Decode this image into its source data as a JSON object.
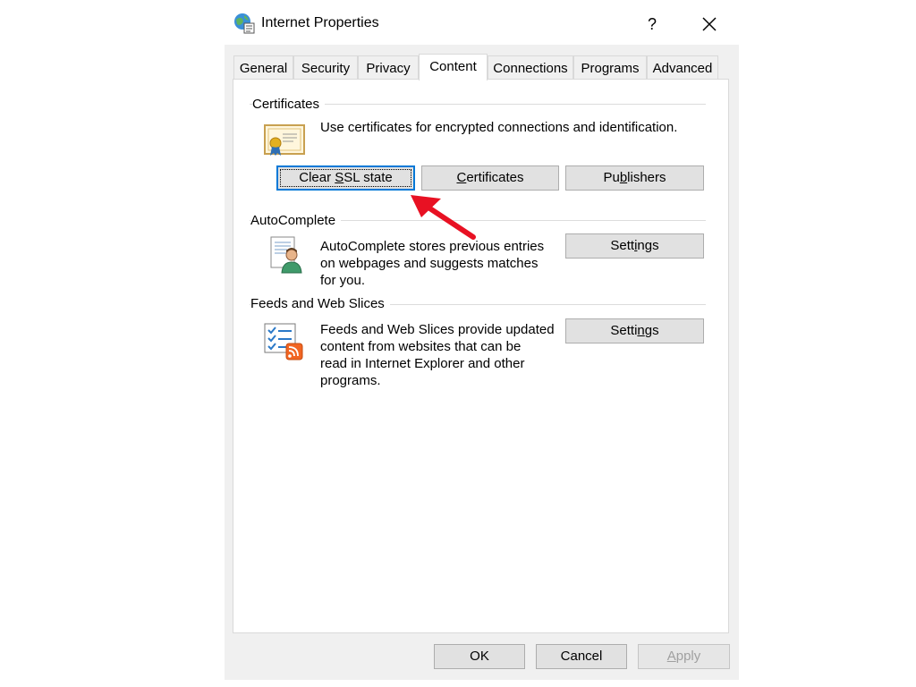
{
  "window": {
    "title": "Internet Properties",
    "help_label": "?",
    "icon": "internet-options-icon"
  },
  "tabs": [
    {
      "label": "General",
      "active": false
    },
    {
      "label": "Security",
      "active": false
    },
    {
      "label": "Privacy",
      "active": false
    },
    {
      "label": "Content",
      "active": true
    },
    {
      "label": "Connections",
      "active": false
    },
    {
      "label": "Programs",
      "active": false
    },
    {
      "label": "Advanced",
      "active": false
    }
  ],
  "certificates": {
    "heading": "Certificates",
    "description": "Use certificates for encrypted connections and identification.",
    "icon": "certificate-icon",
    "buttons": {
      "clear_ssl": {
        "pre": "Clear ",
        "key": "S",
        "post": "SL state"
      },
      "certificates": {
        "pre": "",
        "key": "C",
        "post": "ertificates"
      },
      "publishers": {
        "pre": "Pu",
        "key": "b",
        "post": "lishers"
      }
    }
  },
  "autocomplete": {
    "heading": "AutoComplete",
    "description_lines": [
      "AutoComplete stores previous entries",
      "on webpages and suggests matches",
      "for you."
    ],
    "icon": "autocomplete-user-icon",
    "settings": {
      "pre": "Sett",
      "key": "i",
      "post": "ngs"
    }
  },
  "feeds": {
    "heading": "Feeds and Web Slices",
    "description_lines": [
      "Feeds and Web Slices provide updated",
      "content from websites that can be",
      "read in Internet Explorer and other",
      "programs."
    ],
    "icon": "feeds-rss-icon",
    "settings": {
      "pre": "Setti",
      "key": "n",
      "post": "gs"
    }
  },
  "footer": {
    "ok": "OK",
    "cancel": "Cancel",
    "apply": {
      "pre": "",
      "key": "A",
      "post": "pply"
    }
  },
  "colors": {
    "focus_border": "#0078d7",
    "annotation_arrow": "#e81123",
    "rss_orange": "#f26522"
  }
}
